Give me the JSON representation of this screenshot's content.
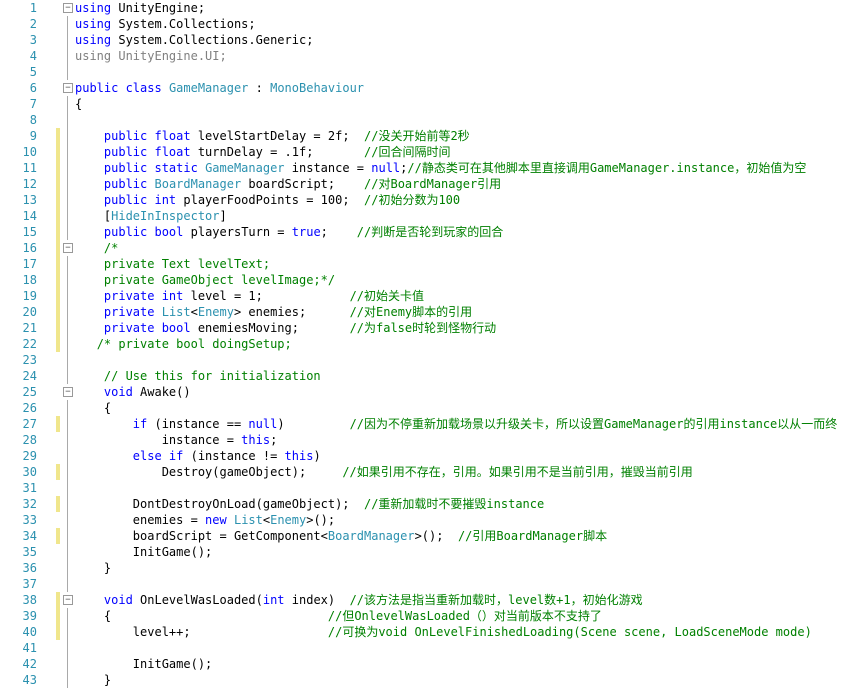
{
  "colors": {
    "keyword": "#0000ff",
    "type": "#2b91af",
    "comment": "#008000",
    "line_number": "#2b91af",
    "change_marker": "#f0e68c",
    "background": "#ffffff"
  },
  "lines": [
    {
      "n": "1",
      "marker": "",
      "fold": "minus",
      "tokens": [
        {
          "s": "k",
          "t": "using"
        },
        {
          "s": "",
          "t": " UnityEngine;"
        }
      ]
    },
    {
      "n": "2",
      "marker": "",
      "tokens": [
        {
          "s": "k",
          "t": "using"
        },
        {
          "s": "",
          "t": " System.Collections;"
        }
      ]
    },
    {
      "n": "3",
      "marker": "",
      "tokens": [
        {
          "s": "k",
          "t": "using"
        },
        {
          "s": "",
          "t": " System.Collections.Generic;"
        }
      ]
    },
    {
      "n": "4",
      "marker": "",
      "tokens": [
        {
          "s": "g",
          "t": "using UnityEngine.UI;"
        }
      ]
    },
    {
      "n": "5",
      "marker": "",
      "tokens": []
    },
    {
      "n": "6",
      "marker": "",
      "fold": "minus",
      "tokens": [
        {
          "s": "k",
          "t": "public class"
        },
        {
          "s": "",
          "t": " "
        },
        {
          "s": "t",
          "t": "GameManager"
        },
        {
          "s": "",
          "t": " : "
        },
        {
          "s": "t",
          "t": "MonoBehaviour"
        }
      ]
    },
    {
      "n": "7",
      "marker": "",
      "tokens": [
        {
          "s": "",
          "t": "{"
        }
      ]
    },
    {
      "n": "8",
      "marker": "",
      "tokens": []
    },
    {
      "n": "9",
      "marker": "yellow",
      "tokens": [
        {
          "s": "",
          "t": "    "
        },
        {
          "s": "k",
          "t": "public float"
        },
        {
          "s": "",
          "t": " levelStartDelay = 2f;  "
        },
        {
          "s": "c",
          "t": "//没关开始前等2秒"
        }
      ]
    },
    {
      "n": "10",
      "marker": "yellow",
      "tokens": [
        {
          "s": "",
          "t": "    "
        },
        {
          "s": "k",
          "t": "public float"
        },
        {
          "s": "",
          "t": " turnDelay = .1f;       "
        },
        {
          "s": "c",
          "t": "//回合间隔时间"
        }
      ]
    },
    {
      "n": "11",
      "marker": "yellow",
      "tokens": [
        {
          "s": "",
          "t": "    "
        },
        {
          "s": "k",
          "t": "public static"
        },
        {
          "s": "",
          "t": " "
        },
        {
          "s": "t",
          "t": "GameManager"
        },
        {
          "s": "",
          "t": " instance = "
        },
        {
          "s": "k",
          "t": "null"
        },
        {
          "s": "",
          "t": ";"
        },
        {
          "s": "c",
          "t": "//静态类可在其他脚本里直接调用GameManager.instance，初始值为空"
        }
      ]
    },
    {
      "n": "12",
      "marker": "yellow",
      "tokens": [
        {
          "s": "",
          "t": "    "
        },
        {
          "s": "k",
          "t": "public"
        },
        {
          "s": "",
          "t": " "
        },
        {
          "s": "t",
          "t": "BoardManager"
        },
        {
          "s": "",
          "t": " boardScript;    "
        },
        {
          "s": "c",
          "t": "//对BoardManager引用"
        }
      ]
    },
    {
      "n": "13",
      "marker": "yellow",
      "tokens": [
        {
          "s": "",
          "t": "    "
        },
        {
          "s": "k",
          "t": "public int"
        },
        {
          "s": "",
          "t": " playerFoodPoints = 100;  "
        },
        {
          "s": "c",
          "t": "//初始分数为100"
        }
      ]
    },
    {
      "n": "14",
      "marker": "yellow",
      "tokens": [
        {
          "s": "",
          "t": "    ["
        },
        {
          "s": "t",
          "t": "HideInInspector"
        },
        {
          "s": "",
          "t": "]"
        }
      ]
    },
    {
      "n": "15",
      "marker": "yellow",
      "tokens": [
        {
          "s": "",
          "t": "    "
        },
        {
          "s": "k",
          "t": "public bool"
        },
        {
          "s": "",
          "t": " playersTurn = "
        },
        {
          "s": "k",
          "t": "true"
        },
        {
          "s": "",
          "t": ";    "
        },
        {
          "s": "c",
          "t": "//判断是否轮到玩家的回合"
        }
      ]
    },
    {
      "n": "16",
      "marker": "yellow",
      "fold": "minus",
      "tokens": [
        {
          "s": "",
          "t": "    "
        },
        {
          "s": "c",
          "t": "/*"
        }
      ]
    },
    {
      "n": "17",
      "marker": "yellow",
      "tokens": [
        {
          "s": "",
          "t": "    "
        },
        {
          "s": "c",
          "t": "private Text levelText;"
        }
      ]
    },
    {
      "n": "18",
      "marker": "yellow",
      "tokens": [
        {
          "s": "",
          "t": "    "
        },
        {
          "s": "c",
          "t": "private GameObject levelImage;*/"
        }
      ]
    },
    {
      "n": "19",
      "marker": "yellow",
      "tokens": [
        {
          "s": "",
          "t": "    "
        },
        {
          "s": "k",
          "t": "private int"
        },
        {
          "s": "",
          "t": " level = 1;            "
        },
        {
          "s": "c",
          "t": "//初始关卡值"
        }
      ]
    },
    {
      "n": "20",
      "marker": "yellow",
      "tokens": [
        {
          "s": "",
          "t": "    "
        },
        {
          "s": "k",
          "t": "private"
        },
        {
          "s": "",
          "t": " "
        },
        {
          "s": "t",
          "t": "List"
        },
        {
          "s": "",
          "t": "<"
        },
        {
          "s": "t",
          "t": "Enemy"
        },
        {
          "s": "",
          "t": "> enemies;      "
        },
        {
          "s": "c",
          "t": "//对Enemy脚本的引用"
        }
      ]
    },
    {
      "n": "21",
      "marker": "yellow",
      "tokens": [
        {
          "s": "",
          "t": "    "
        },
        {
          "s": "k",
          "t": "private bool"
        },
        {
          "s": "",
          "t": " enemiesMoving;       "
        },
        {
          "s": "c",
          "t": "//为false时轮到怪物行动"
        }
      ]
    },
    {
      "n": "22",
      "marker": "yellow",
      "tokens": [
        {
          "s": "",
          "t": "   "
        },
        {
          "s": "c",
          "t": "/* private bool doingSetup;"
        }
      ]
    },
    {
      "n": "23",
      "marker": "",
      "tokens": []
    },
    {
      "n": "24",
      "marker": "",
      "tokens": [
        {
          "s": "",
          "t": "    "
        },
        {
          "s": "c",
          "t": "// Use this for initialization"
        }
      ]
    },
    {
      "n": "25",
      "marker": "",
      "fold": "minus",
      "tokens": [
        {
          "s": "",
          "t": "    "
        },
        {
          "s": "k",
          "t": "void"
        },
        {
          "s": "",
          "t": " Awake()"
        }
      ]
    },
    {
      "n": "26",
      "marker": "",
      "tokens": [
        {
          "s": "",
          "t": "    {"
        }
      ]
    },
    {
      "n": "27",
      "marker": "yellow",
      "tokens": [
        {
          "s": "",
          "t": "        "
        },
        {
          "s": "k",
          "t": "if"
        },
        {
          "s": "",
          "t": " (instance == "
        },
        {
          "s": "k",
          "t": "null"
        },
        {
          "s": "",
          "t": ")         "
        },
        {
          "s": "c",
          "t": "//因为不停重新加载场景以升级关卡，所以设置GameManager的引用instance以从一而终"
        }
      ]
    },
    {
      "n": "28",
      "marker": "",
      "tokens": [
        {
          "s": "",
          "t": "            instance = "
        },
        {
          "s": "k",
          "t": "this"
        },
        {
          "s": "",
          "t": ";"
        }
      ]
    },
    {
      "n": "29",
      "marker": "",
      "tokens": [
        {
          "s": "",
          "t": "        "
        },
        {
          "s": "k",
          "t": "else if"
        },
        {
          "s": "",
          "t": " (instance != "
        },
        {
          "s": "k",
          "t": "this"
        },
        {
          "s": "",
          "t": ")"
        }
      ]
    },
    {
      "n": "30",
      "marker": "yellow",
      "tokens": [
        {
          "s": "",
          "t": "            Destroy(gameObject);     "
        },
        {
          "s": "c",
          "t": "//如果引用不存在，引用。如果引用不是当前引用，摧毁当前引用"
        }
      ]
    },
    {
      "n": "31",
      "marker": "",
      "tokens": []
    },
    {
      "n": "32",
      "marker": "yellow",
      "tokens": [
        {
          "s": "",
          "t": "        DontDestroyOnLoad(gameObject);  "
        },
        {
          "s": "c",
          "t": "//重新加载时不要摧毁instance"
        }
      ]
    },
    {
      "n": "33",
      "marker": "",
      "tokens": [
        {
          "s": "",
          "t": "        enemies = "
        },
        {
          "s": "k",
          "t": "new"
        },
        {
          "s": "",
          "t": " "
        },
        {
          "s": "t",
          "t": "List"
        },
        {
          "s": "",
          "t": "<"
        },
        {
          "s": "t",
          "t": "Enemy"
        },
        {
          "s": "",
          "t": ">();"
        }
      ]
    },
    {
      "n": "34",
      "marker": "yellow",
      "tokens": [
        {
          "s": "",
          "t": "        boardScript = GetComponent<"
        },
        {
          "s": "t",
          "t": "BoardManager"
        },
        {
          "s": "",
          "t": ">();  "
        },
        {
          "s": "c",
          "t": "//引用BoardManager脚本"
        }
      ]
    },
    {
      "n": "35",
      "marker": "",
      "tokens": [
        {
          "s": "",
          "t": "        InitGame();"
        }
      ]
    },
    {
      "n": "36",
      "marker": "",
      "tokens": [
        {
          "s": "",
          "t": "    }"
        }
      ]
    },
    {
      "n": "37",
      "marker": "",
      "tokens": []
    },
    {
      "n": "38",
      "marker": "yellow",
      "fold": "minus",
      "tokens": [
        {
          "s": "",
          "t": "    "
        },
        {
          "s": "k",
          "t": "void"
        },
        {
          "s": "",
          "t": " OnLevelWasLoaded("
        },
        {
          "s": "k",
          "t": "int"
        },
        {
          "s": "",
          "t": " index)  "
        },
        {
          "s": "c",
          "t": "//该方法是指当重新加载时，level数+1，初始化游戏"
        }
      ]
    },
    {
      "n": "39",
      "marker": "yellow",
      "tokens": [
        {
          "s": "",
          "t": "    {                              "
        },
        {
          "s": "c",
          "t": "//但OnlevelWasLoaded（）对当前版本不支持了"
        }
      ]
    },
    {
      "n": "40",
      "marker": "yellow",
      "tokens": [
        {
          "s": "",
          "t": "        level++;                   "
        },
        {
          "s": "c",
          "t": "//可换为void OnLevelFinishedLoading(Scene scene, LoadSceneMode mode)"
        }
      ]
    },
    {
      "n": "41",
      "marker": "",
      "tokens": []
    },
    {
      "n": "42",
      "marker": "",
      "tokens": [
        {
          "s": "",
          "t": "        InitGame();"
        }
      ]
    },
    {
      "n": "43",
      "marker": "",
      "tokens": [
        {
          "s": "",
          "t": "    }"
        }
      ]
    }
  ]
}
